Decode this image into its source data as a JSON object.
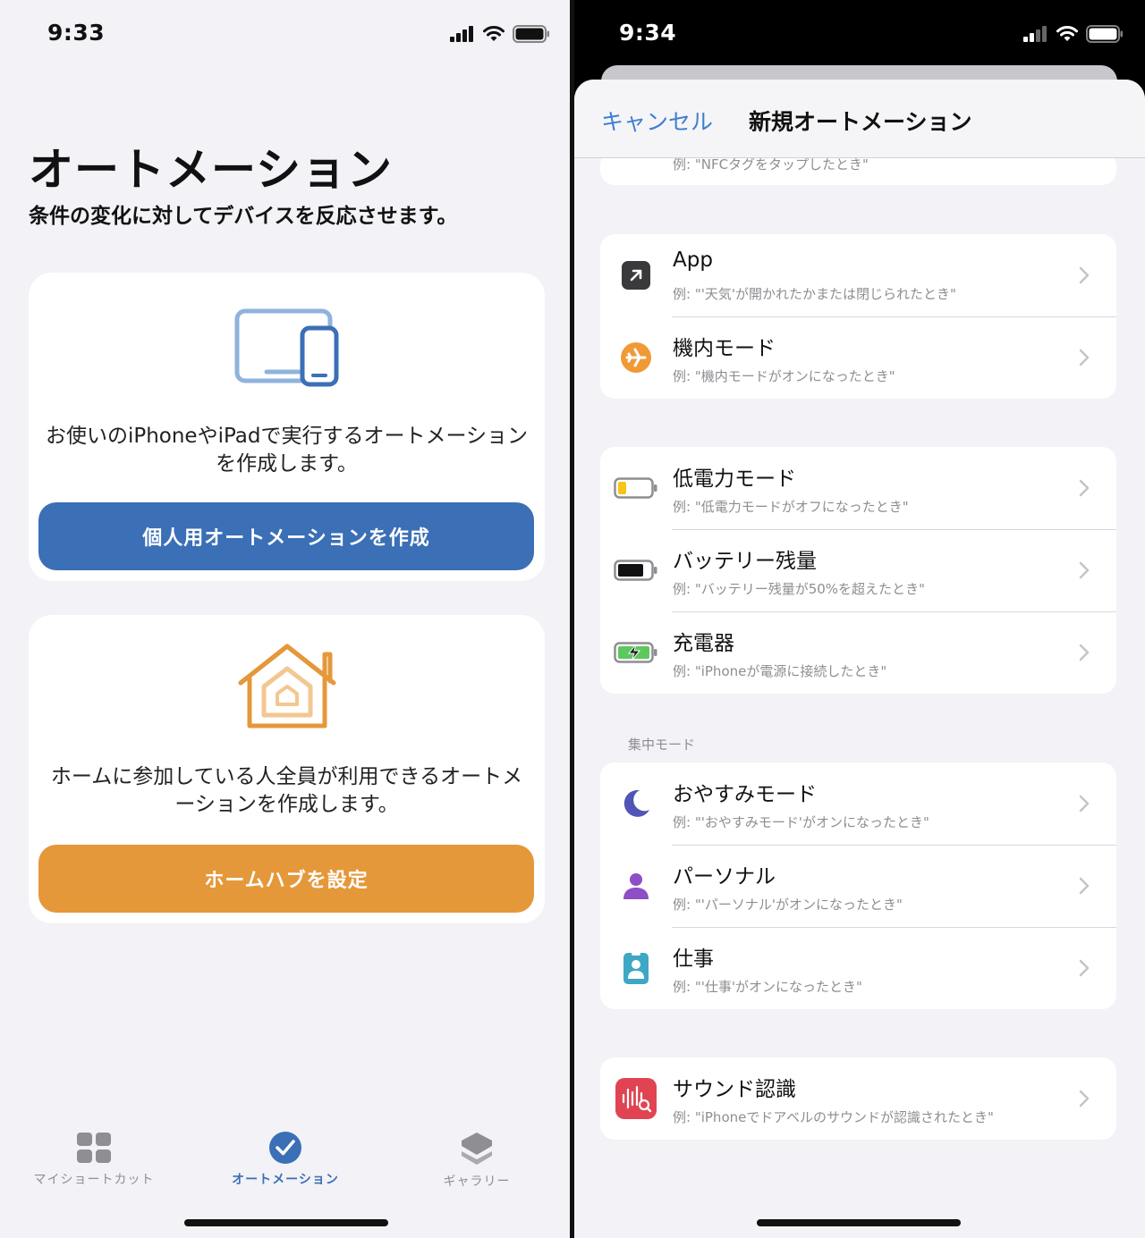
{
  "left": {
    "status": {
      "time": "9:33"
    },
    "title": "オートメーション",
    "subtitle": "条件の変化に対してデバイスを反応させます。",
    "personal_card": {
      "icon": "devices-icon",
      "text": "お使いのiPhoneやiPadで実行するオートメーションを作成します。",
      "button": "個人用オートメーションを作成",
      "button_color": "#3b6fb6"
    },
    "home_card": {
      "icon": "home-icon",
      "text": "ホームに参加している人全員が利用できるオートメーションを作成します。",
      "button": "ホームハブを設定",
      "button_color": "#e5983a"
    },
    "tabs": [
      {
        "label": "マイショートカット",
        "icon": "grid-icon",
        "active": false
      },
      {
        "label": "オートメーション",
        "icon": "checkmark-clock-icon",
        "active": true
      },
      {
        "label": "ギャラリー",
        "icon": "layers-icon",
        "active": false
      }
    ]
  },
  "right": {
    "status": {
      "time": "9:34"
    },
    "nav": {
      "cancel": "キャンセル",
      "title": "新規オートメーション"
    },
    "partial_row": {
      "subtitle": "例: \"NFCタグをタップしたとき\""
    },
    "group1": [
      {
        "title": "App",
        "subtitle": "例: \"'天気'が開かれたかまたは閉じられたとき\"",
        "icon": "app-arrow-icon"
      },
      {
        "title": "機内モード",
        "subtitle": "例: \"機内モードがオンになったとき\"",
        "icon": "airplane-icon"
      }
    ],
    "group2": [
      {
        "title": "低電力モード",
        "subtitle": "例: \"低電力モードがオフになったとき\"",
        "icon": "low-battery-icon"
      },
      {
        "title": "バッテリー残量",
        "subtitle": "例: \"バッテリー残量が50%を超えたとき\"",
        "icon": "battery-icon"
      },
      {
        "title": "充電器",
        "subtitle": "例: \"iPhoneが電源に接続したとき\"",
        "icon": "charging-battery-icon"
      }
    ],
    "focus_section": "集中モード",
    "group3": [
      {
        "title": "おやすみモード",
        "subtitle": "例: \"'おやすみモード'がオンになったとき\"",
        "icon": "moon-icon"
      },
      {
        "title": "パーソナル",
        "subtitle": "例: \"'パーソナル'がオンになったとき\"",
        "icon": "person-icon"
      },
      {
        "title": "仕事",
        "subtitle": "例: \"'仕事'がオンになったとき\"",
        "icon": "id-badge-icon"
      }
    ],
    "group4": [
      {
        "title": "サウンド認識",
        "subtitle": "例: \"iPhoneでドアベルのサウンドが認識されたとき\"",
        "icon": "sound-recognition-icon"
      }
    ]
  },
  "colors": {
    "accent_blue": "#3d7fd0",
    "home_orange": "#e5983a",
    "background": "#f2f2f7"
  }
}
